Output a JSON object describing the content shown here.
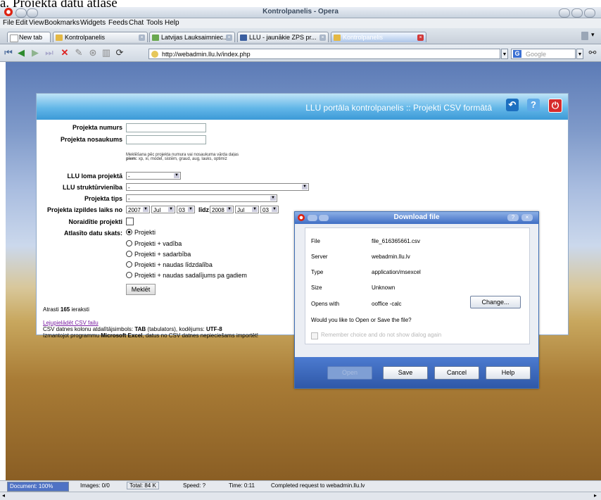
{
  "caption": "a. Projekta datu atlase",
  "window": {
    "title": "Kontrolpanelis - Opera"
  },
  "menu": [
    "File",
    "Edit",
    "View",
    "Bookmarks",
    "Widgets",
    "Feeds",
    "Chat",
    "Tools",
    "Help"
  ],
  "tabs": [
    {
      "label": "New tab"
    },
    {
      "label": "Kontrolpanelis"
    },
    {
      "label": "Latvijas Lauksaimniec..."
    },
    {
      "label": "LLU - jaunākie ZPS pr..."
    },
    {
      "label": "Kontrolpanelis"
    }
  ],
  "address": {
    "url": "http://webadmin.llu.lv/index.php",
    "search_placeholder": "Google"
  },
  "panel": {
    "title": "LLU portāla kontrolpanelis :: Projekti CSV formātā",
    "colors": {
      "header": "#3c9ad7",
      "bg": "#ffffff"
    }
  },
  "form": {
    "numurs_label": "Projekta numurs",
    "nosaukums_label": "Projekta nosaukums",
    "hint_line1": "Meklēšana pēc projekta numura vai nosaukuma vārda daļas",
    "hint_bold": "piem:",
    "hint_line2": "xp, xi, model, sistēm, graud, aug, lauks, optimiz",
    "loma_label": "LLU loma projektā",
    "loma_value": "-",
    "struktura_label": "LLU struktūrvienība",
    "struktura_value": "-",
    "tips_label": "Projekta tips",
    "tips_value": "-",
    "laiks_label": "Projekta izpildes laiks no",
    "year_from": "2007",
    "month_from": "Jul",
    "day_from": "03",
    "lidz_label": "līdz",
    "year_to": "2008",
    "month_to": "Jul",
    "day_to": "03",
    "noraiditie_label": "Noraidītie projekti",
    "skats_label": "Atlasīto datu skats:",
    "options": [
      "Projekti",
      "Projekti + vadība",
      "Projekti + sadarbība",
      "Projekti + naudas līdzdalība",
      "Projekti + naudas sadalījums pa gadiem"
    ],
    "search_button": "Meklēt"
  },
  "results": {
    "prefix": "Atrasti",
    "count": "165",
    "suffix": "ieraksti",
    "download_link": "Lejupielādēt CSV failu",
    "info_1_pre": "CSV datnes kolonu atdalītājsimbols:",
    "info_1_b1": "TAB",
    "info_1_mid": "(tabulators), kodējums:",
    "info_1_b2": "UTF-8",
    "info_2_pre": "Izmantojot programmu",
    "info_2_b": "Microsoft Excel",
    "info_2_post": ", datus no CSV datnes nepieciešams importēt!"
  },
  "dialog": {
    "title": "Download file",
    "file_label": "File",
    "file_value": "file_616365661.csv",
    "server_label": "Server",
    "server_value": "webadmin.llu.lv",
    "type_label": "Type",
    "type_value": "application/msexcel",
    "size_label": "Size",
    "size_value": "Unknown",
    "opens_label": "Opens with",
    "opens_value": "ooffice -calc",
    "change_button": "Change...",
    "question": "Would you like to Open or Save the file?",
    "remember": "Remember choice and do not show dialog again",
    "open_button": "Open",
    "save_button": "Save",
    "cancel_button": "Cancel",
    "help_button": "Help"
  },
  "status": {
    "document": "Document:",
    "progress": "100%",
    "progress_fraction": 1.0,
    "images": "Images: 0/0",
    "total": "Total: 84 K",
    "speed": "Speed: ?",
    "time": "Time: 0:11",
    "message": "Completed request to webadmin.llu.lv"
  }
}
